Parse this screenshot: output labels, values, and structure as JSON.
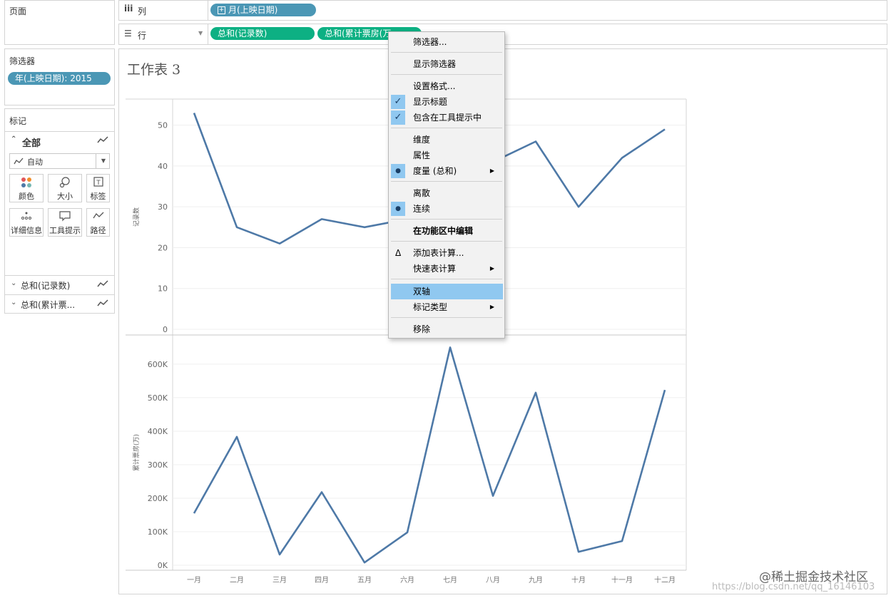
{
  "pages_panel": {
    "title": "页面"
  },
  "columns_shelf": {
    "label": "列",
    "pill": "月(上映日期)"
  },
  "rows_shelf": {
    "label": "行",
    "pills": [
      "总和(记录数)",
      "总和(累计票房(万…"
    ]
  },
  "filters_panel": {
    "title": "筛选器",
    "pill": "年(上映日期): 2015"
  },
  "marks_panel": {
    "title": "标记",
    "all_label": "全部",
    "mark_type": "自动",
    "buttons": [
      "颜色",
      "大小",
      "标签",
      "详细信息",
      "工具提示",
      "路径"
    ],
    "measures": [
      "总和(记录数)",
      "总和(累计票..."
    ]
  },
  "sheet": {
    "title": "工作表 3"
  },
  "context_menu": {
    "items": [
      {
        "label": "筛选器..."
      },
      {
        "label": "显示筛选器"
      },
      {
        "label": "设置格式..."
      },
      {
        "label": "显示标题",
        "checked": true
      },
      {
        "label": "包含在工具提示中",
        "checked": true
      },
      {
        "label": "维度"
      },
      {
        "label": "属性"
      },
      {
        "label": "度量 (总和)",
        "selected": true,
        "submenu": true
      },
      {
        "label": "离散"
      },
      {
        "label": "连续",
        "selected": true
      },
      {
        "label": "在功能区中编辑",
        "bold": true
      },
      {
        "label": "添加表计算...",
        "symbol": "Δ"
      },
      {
        "label": "快速表计算",
        "submenu": true
      },
      {
        "label": "双轴",
        "highlighted": true
      },
      {
        "label": "标记类型",
        "submenu": true
      },
      {
        "label": "移除"
      }
    ]
  },
  "watermark": {
    "brand": "@稀土掘金技术社区",
    "url": "https://blog.csdn.net/qq_16146103"
  },
  "chart_data": [
    {
      "type": "line",
      "ylabel": "记录数",
      "categories": [
        "一月",
        "二月",
        "三月",
        "四月",
        "五月",
        "六月",
        "七月",
        "八月",
        "九月",
        "十月",
        "十一月",
        "十二月"
      ],
      "values": [
        53,
        25,
        21,
        27,
        25,
        27,
        38,
        41,
        46,
        30,
        42,
        49
      ],
      "ylim": [
        0,
        55
      ],
      "yticks": [
        0,
        10,
        20,
        30,
        40,
        50
      ],
      "ytick_labels": [
        "0",
        "10",
        "20",
        "30",
        "40",
        "50"
      ],
      "grid": true,
      "color": "#4e79a7"
    },
    {
      "type": "line",
      "ylabel": "累计票房(万)",
      "categories": [
        "一月",
        "二月",
        "三月",
        "四月",
        "五月",
        "六月",
        "七月",
        "八月",
        "九月",
        "十月",
        "十一月",
        "十二月"
      ],
      "values": [
        155000,
        383000,
        32000,
        218000,
        8000,
        98000,
        650000,
        207000,
        515000,
        40000,
        72000,
        523000
      ],
      "ylim": [
        0,
        670000
      ],
      "yticks": [
        0,
        100000,
        200000,
        300000,
        400000,
        500000,
        600000
      ],
      "ytick_labels": [
        "0K",
        "100K",
        "200K",
        "300K",
        "400K",
        "500K",
        "600K"
      ],
      "grid": true,
      "color": "#4e79a7"
    }
  ]
}
